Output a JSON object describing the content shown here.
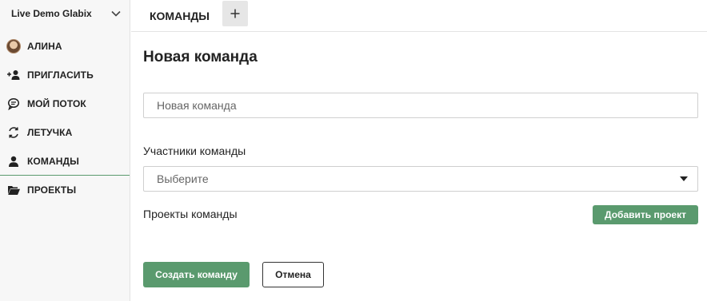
{
  "sidebar": {
    "workspace_name": "Live Demo Glabix",
    "workspace_icon": "chevron-down-icon",
    "items": [
      {
        "label": "АЛИНА",
        "icon": "avatar"
      },
      {
        "label": "ПРИГЛАСИТЬ",
        "icon": "add-user-icon"
      },
      {
        "label": "МОЙ ПОТОК",
        "icon": "chat-bubble-icon"
      },
      {
        "label": "ЛЕТУЧКА",
        "icon": "refresh-icon"
      },
      {
        "label": "КОМАНДЫ",
        "icon": "user-icon",
        "active": true
      },
      {
        "label": "ПРОЕКТЫ",
        "icon": "folder-open-icon"
      }
    ]
  },
  "topbar": {
    "tab_label": "КОМАНДЫ",
    "add_tab_icon": "plus-icon"
  },
  "form": {
    "title": "Новая команда",
    "name_placeholder": "Новая команда",
    "name_value": "",
    "members_label": "Участники команды",
    "members_select_value": "Выберите",
    "projects_label": "Проекты команды",
    "add_project_label": "Добавить проект",
    "create_label": "Создать команду",
    "cancel_label": "Отмена"
  },
  "colors": {
    "accent_green": "#5a9a6e",
    "sidebar_bg": "#f7f7f7",
    "border": "#cfcfcf"
  }
}
